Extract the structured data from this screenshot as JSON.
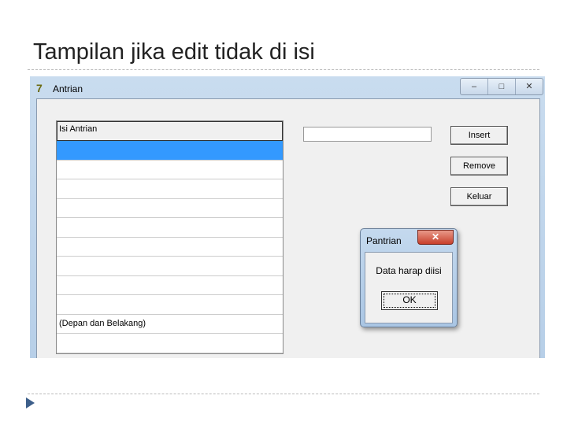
{
  "slide": {
    "title": "Tampilan jika edit tidak di isi"
  },
  "window": {
    "title": "Antrian",
    "controls": [
      "–",
      "□",
      "✕"
    ]
  },
  "list": {
    "header": "Isi Antrian",
    "rows": [
      "",
      "",
      "",
      "",
      "",
      "",
      "",
      "",
      "",
      "(Depan dan Belakang)",
      ""
    ],
    "selected_index": 0
  },
  "input": {
    "value": ""
  },
  "buttons": {
    "insert": "Insert",
    "remove": "Remove",
    "keluar": "Keluar"
  },
  "dialog": {
    "title": "Pantrian",
    "message": "Data harap diisi",
    "ok": "OK",
    "close": "✕"
  }
}
